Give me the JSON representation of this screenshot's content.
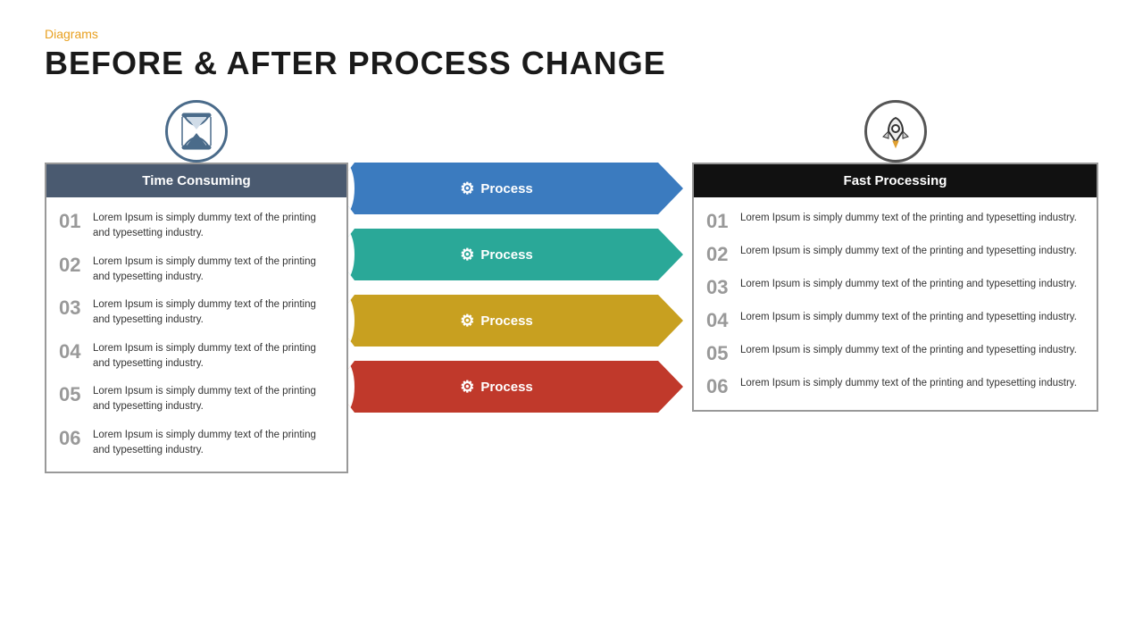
{
  "header": {
    "category": "Diagrams",
    "title": "BEFORE & AFTER PROCESS CHANGE"
  },
  "left_panel": {
    "icon_label": "hourglass-icon",
    "header": "Time Consuming",
    "items": [
      {
        "number": "01",
        "text": "Lorem Ipsum is simply dummy text of the printing and typesetting industry."
      },
      {
        "number": "02",
        "text": "Lorem Ipsum is simply dummy text of the printing and typesetting industry."
      },
      {
        "number": "03",
        "text": "Lorem Ipsum is simply dummy text of the printing and typesetting industry."
      },
      {
        "number": "04",
        "text": "Lorem Ipsum is simply dummy text of the printing and typesetting industry."
      },
      {
        "number": "05",
        "text": "Lorem Ipsum is simply dummy text of the printing and typesetting industry."
      },
      {
        "number": "06",
        "text": "Lorem Ipsum is simply dummy text of the printing and typesetting industry."
      }
    ]
  },
  "middle_arrows": [
    {
      "label": "Process",
      "color": "#3b7bbf",
      "tip_color": "#3b7bbf"
    },
    {
      "label": "Process",
      "color": "#2aa898",
      "tip_color": "#2aa898"
    },
    {
      "label": "Process",
      "color": "#c8a020",
      "tip_color": "#c8a020"
    },
    {
      "label": "Process",
      "color": "#c0392b",
      "tip_color": "#c0392b"
    }
  ],
  "right_panel": {
    "icon_label": "rocket-icon",
    "header": "Fast Processing",
    "items": [
      {
        "number": "01",
        "text": "Lorem Ipsum is simply dummy text of the printing and typesetting industry."
      },
      {
        "number": "02",
        "text": "Lorem Ipsum is simply dummy text of the printing and typesetting industry."
      },
      {
        "number": "03",
        "text": "Lorem Ipsum is simply dummy text of the printing and typesetting industry."
      },
      {
        "number": "04",
        "text": "Lorem Ipsum is simply dummy text of the printing and typesetting industry."
      },
      {
        "number": "05",
        "text": "Lorem Ipsum is simply dummy text of the printing and typesetting industry."
      },
      {
        "number": "06",
        "text": "Lorem Ipsum is simply dummy text of the printing and typesetting industry."
      }
    ]
  },
  "colors": {
    "orange": "#e8a020",
    "left_header_bg": "#4a5a70",
    "right_header_bg": "#111111",
    "blue": "#3b7bbf",
    "teal": "#2aa898",
    "yellow": "#c8a020",
    "red": "#c0392b"
  }
}
